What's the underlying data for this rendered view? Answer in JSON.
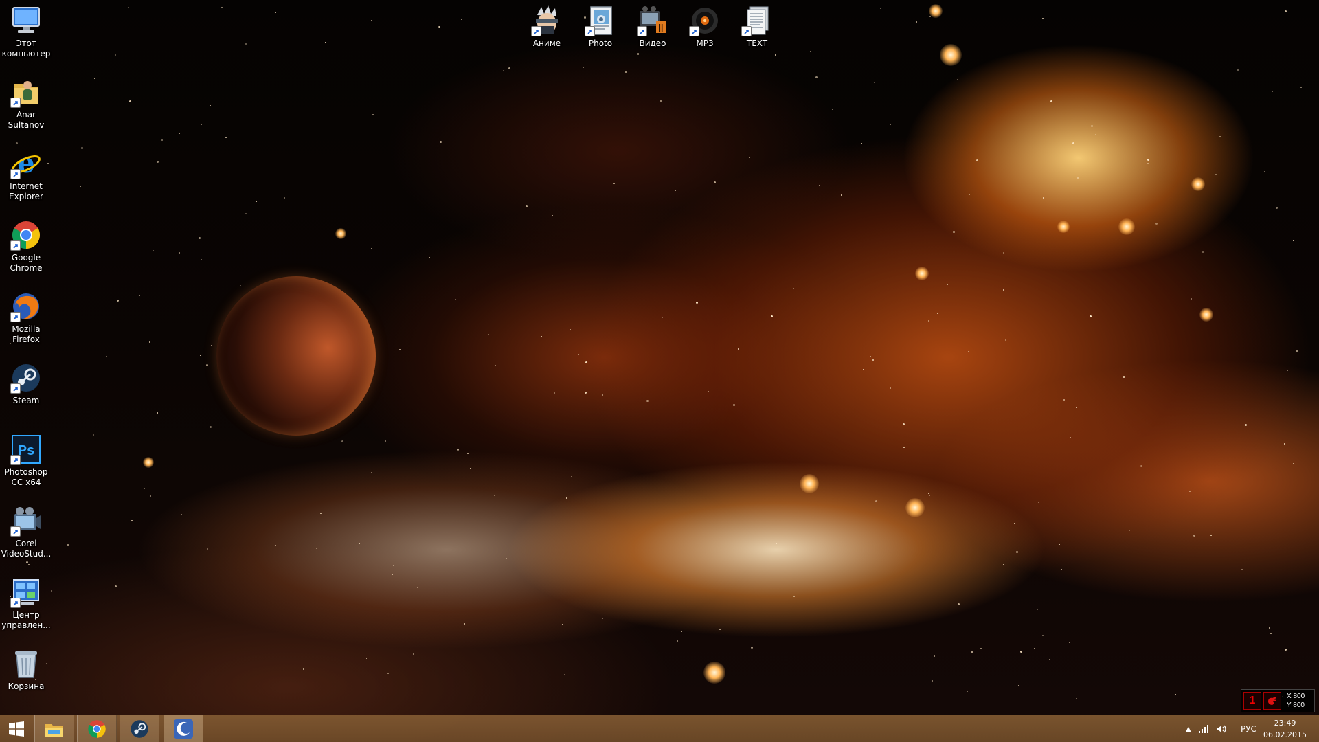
{
  "desktop_icons_left": [
    {
      "label": "Этот\nкомпьютер",
      "icon": "computer-icon"
    },
    {
      "label": "Anar\nSultanov",
      "icon": "user-folder-icon"
    },
    {
      "label": "Internet\nExplorer",
      "icon": "internet-explorer-icon"
    },
    {
      "label": "Google\nChrome",
      "icon": "chrome-icon"
    },
    {
      "label": "Mozilla\nFirefox",
      "icon": "firefox-icon"
    },
    {
      "label": "Steam",
      "icon": "steam-icon"
    },
    {
      "label": "Photoshop\nCC x64",
      "icon": "photoshop-icon"
    },
    {
      "label": "Corel\nVideoStud...",
      "icon": "corel-videostudio-icon"
    },
    {
      "label": "Центр\nуправлен...",
      "icon": "control-panel-icon"
    },
    {
      "label": "Корзина",
      "icon": "recycle-bin-icon"
    }
  ],
  "desktop_icons_top": [
    {
      "label": "Аниме",
      "icon": "anime-folder-icon"
    },
    {
      "label": "Photo",
      "icon": "photo-folder-icon"
    },
    {
      "label": "Видео",
      "icon": "video-folder-icon"
    },
    {
      "label": "MP3",
      "icon": "mp3-folder-icon"
    },
    {
      "label": "TEXT",
      "icon": "text-folder-icon"
    }
  ],
  "overlay_widget": {
    "number": "1",
    "x_label": "X 800",
    "y_label": "Y 800"
  },
  "taskbar": {
    "apps": [
      "file-explorer-icon",
      "chrome-icon",
      "steam-icon",
      "moon-app-icon"
    ],
    "tray": {
      "language": "РУС",
      "time": "23:49",
      "date": "06.02.2015"
    }
  },
  "colors": {
    "taskbar": "#7a5430",
    "accent": "#ff8a2a"
  }
}
